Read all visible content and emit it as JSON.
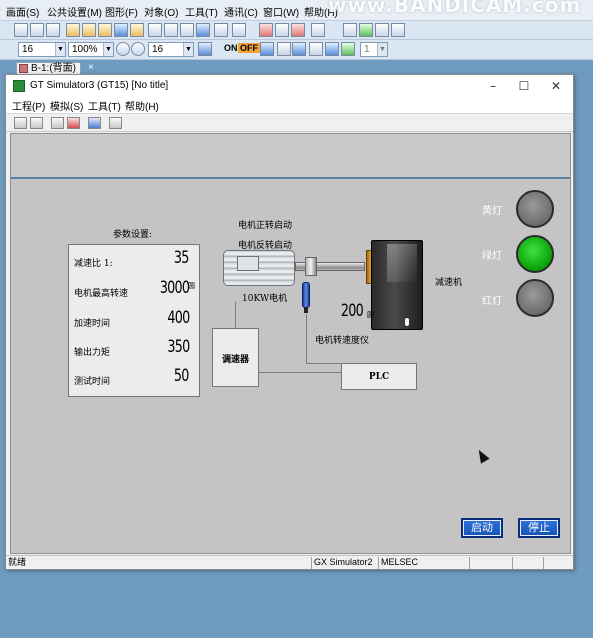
{
  "outer": {
    "menu": [
      "画面(S)",
      "公共设置(M)",
      "图形(F)",
      "对象(O)",
      "工具(T)",
      "通讯(C)",
      "窗口(W)",
      "帮助(H)"
    ],
    "watermark": "www.BANDICAM.com",
    "toolbar": {
      "font_size": "16",
      "zoom": "100%",
      "size2": "16",
      "on_label": "ON",
      "off_label": "OFF",
      "num": "1"
    },
    "tab_label": "B-1:(背面)"
  },
  "sim": {
    "title": "GT Simulator3 (GT15)  [No title]",
    "menu": [
      "工程(P)",
      "模拟(S)",
      "工具(T)",
      "帮助(H)"
    ],
    "status": {
      "ready": "就绪",
      "simulator": "GX Simulator2",
      "target": "MELSEC"
    }
  },
  "hmi": {
    "labels": {
      "params_title": "参数设置:",
      "motor_forward": "电机正转启动",
      "motor_reverse": "电机反转启动",
      "motor_name": "10KW电机",
      "gearbox": "减速机",
      "tachometer": "电机转速度仪",
      "controller": "调速器",
      "plc": "PLC",
      "unit_small": "圆"
    },
    "params": [
      {
        "label": "减速比 1:",
        "value": "35"
      },
      {
        "label": "电机最高转速",
        "value": "3000"
      },
      {
        "label": "加速时间",
        "value": "400"
      },
      {
        "label": "输出力矩",
        "value": "350"
      },
      {
        "label": "测试时间",
        "value": "50"
      }
    ],
    "tachometer_value": "200",
    "lamps": [
      {
        "label": "黄灯",
        "state": "off"
      },
      {
        "label": "绿灯",
        "state": "on"
      },
      {
        "label": "红灯",
        "state": "off"
      }
    ],
    "buttons": {
      "start": "启动",
      "stop": "停止"
    },
    "colors": {
      "lamp_on": "#08a008",
      "lamp_off": "#6c6c6c",
      "button": "#1453b8",
      "header_rule": "#5e7fa4"
    }
  }
}
